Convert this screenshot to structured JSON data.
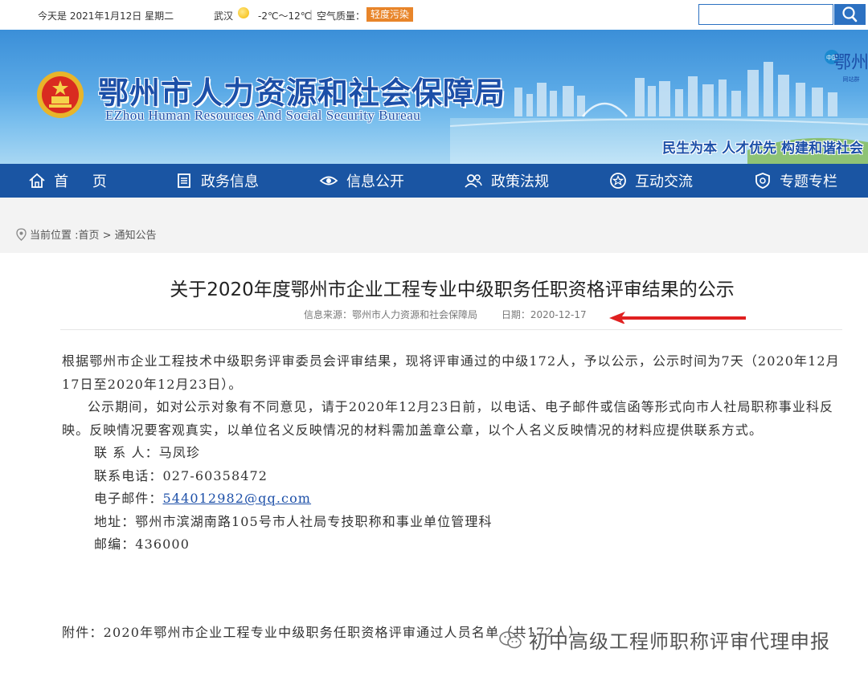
{
  "topbar": {
    "date": "今天是 2021年1月12日 星期二",
    "city": "武汉",
    "temperature": "-2℃～12℃",
    "air_quality_label": "空气质量：",
    "pollution_badge": "轻度污染",
    "pollution_color": "#e8852a",
    "search_placeholder": ""
  },
  "banner": {
    "title_cn": "鄂州市人力资源和社会保障局",
    "title_en": "EZhou Human Resources And Social Security Bureau",
    "slogan": "民生为本 人才优先 构建和谐社会",
    "logo_text": "鄂州",
    "logo_caption": "网站群"
  },
  "nav": {
    "items": [
      {
        "label": "首 页",
        "icon": "home-icon"
      },
      {
        "label": "政务信息",
        "icon": "document-icon"
      },
      {
        "label": "信息公开",
        "icon": "eye-icon"
      },
      {
        "label": "政策法规",
        "icon": "people-icon"
      },
      {
        "label": "互动交流",
        "icon": "star-icon"
      },
      {
        "label": "专题专栏",
        "icon": "shield-icon"
      }
    ]
  },
  "breadcrumb": {
    "text": "当前位置 :首页 > 通知公告"
  },
  "article": {
    "title": "关于2020年度鄂州市企业工程专业中级职务任职资格评审结果的公示",
    "source": "信息来源：鄂州市人力资源和社会保障局",
    "date": "日期：2020-12-17",
    "para1": "根据鄂州市企业工程技术中级职务评审委员会评审结果，现将评审通过的中级172人，予以公示，公示时间为7天（2020年12月17日至2020年12月23日）。",
    "para2": "公示期间，如对公示对象有不同意见，请于2020年12月23日前，以电话、电子邮件或信函等形式向市人社局职称事业科反映。反映情况要客观真实，以单位名义反映情况的材料需加盖章公章，以个人名义反映情况的材料应提供联系方式。",
    "contact_person": "联 系 人：马凤珍",
    "phone": "联系电话：027-60358472",
    "email_label": "电子邮件：",
    "email": "544012982@qq.com",
    "address": "地址：鄂州市滨湖南路105号市人社局专技职称和事业单位管理科",
    "postcode": "邮编：436000",
    "attachment": "附件：2020年鄂州市企业工程专业中级职务任职资格评审通过人员名单（共172人）"
  },
  "watermark": {
    "text": "初中高级工程师职称评审代理申报"
  },
  "colors": {
    "nav_bg": "#1a55a3",
    "title_blue": "#1c4fa8",
    "arrow_red": "#e02020"
  }
}
